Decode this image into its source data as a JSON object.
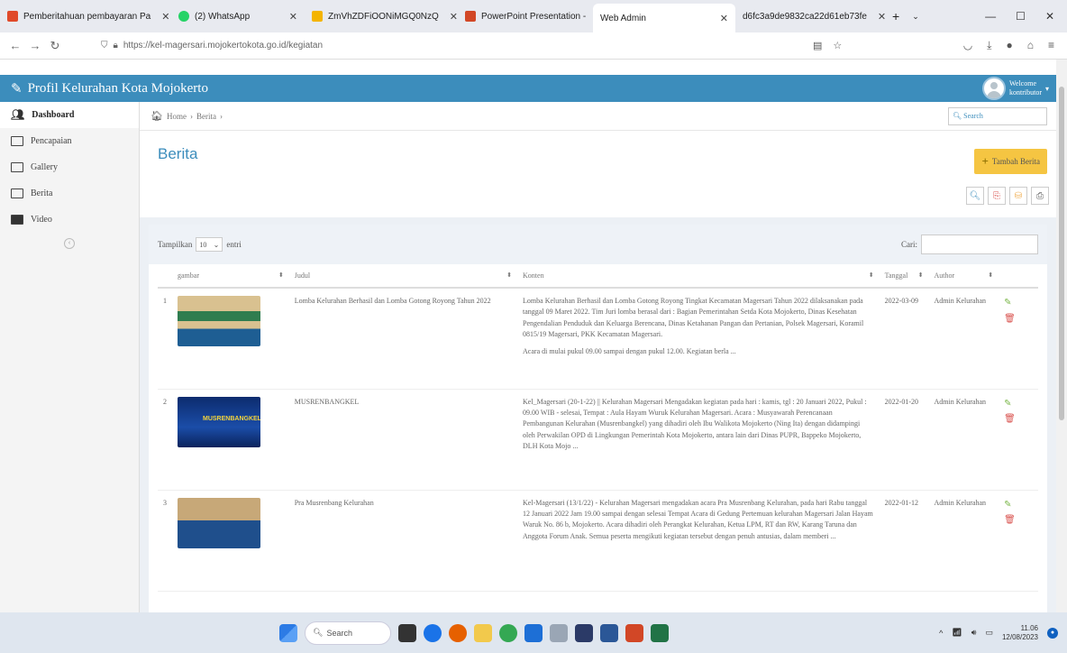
{
  "browser": {
    "tabs": [
      {
        "label": "Pemberitahuan pembayaran Pa",
        "color": "#e04a2a"
      },
      {
        "label": "(2) WhatsApp",
        "color": "#25d366"
      },
      {
        "label": "ZmVhZDFiOONiMGQ0NzQ",
        "color": "#f4b400"
      },
      {
        "label": "PowerPoint Presentation -",
        "color": "#d24726"
      },
      {
        "label": "Web Admin",
        "color": "#ffffff"
      },
      {
        "label": "d6fc3a9de9832ca22d61eb73fe",
        "color": "#888888"
      }
    ],
    "url": "https://kel-magersari.mojokertokota.go.id/kegiatan"
  },
  "app": {
    "brand": "Profil Kelurahan Kota Mojokerto",
    "user_line1": "Welcome",
    "user_line2": "kontributor"
  },
  "sidebar": {
    "items": [
      {
        "label": "Dashboard"
      },
      {
        "label": "Pencapaian"
      },
      {
        "label": "Gallery"
      },
      {
        "label": "Berita"
      },
      {
        "label": "Video"
      }
    ]
  },
  "breadcrumb": {
    "home": "Home",
    "current": "Berita",
    "search_placeholder": "Search"
  },
  "page": {
    "title": "Berita",
    "add_button": "Tambah Berita"
  },
  "table": {
    "show_label": "Tampilkan",
    "show_value": "10",
    "entries_label": "entri",
    "search_label": "Cari:",
    "headers": [
      "gambar",
      "Judul",
      "Konten",
      "Tanggal",
      "Author"
    ],
    "rows": [
      {
        "no": "1",
        "title": "Lomba Kelurahan Berhasil dan Lomba Gotong Royong Tahun 2022",
        "content": "Lomba Kelurahan Berhasil dan Lomba Gotong Royong Tingkat Kecamatan Magersari Tahun 2022 dilaksanakan pada tanggal 09 Maret 2022. Tim Juri lomba berasal dari : Bagian Pemerintahan Setda Kota Mojokerto, Dinas Kesehatan Pengendalian Penduduk dan Keluarga Berencana, Dinas Ketahanan Pangan dan Pertanian, Polsek Magersari, Koramil 0815/19 Magersari, PKK Kecamatan Magersari.",
        "content2": "Acara di mulai pukul 09.00 sampai dengan pukul 12.00. Kegiatan berla ...",
        "date": "2022-03-09",
        "author": "Admin Kelurahan"
      },
      {
        "no": "2",
        "title": "MUSRENBANGKEL",
        "content": "Kel_Magersari (20-1-22) || Kelurahan Magersari Mengadakan kegiatan pada hari : kamis, tgl : 20 Januari 2022, Pukul : 09.00 WIB - selesai, Tempat : Aula Hayam Wuruk Kelurahan Magersari. Acara : Musyawarah Perencanaan Pembangunan Kelurahan (Musrenbangkel) yang dihadiri oleh Ibu Walikota Mojokerto (Ning Ita) dengan didampingi oleh Perwakilan OPD di Lingkungan Pemerintah Kota Mojokerto, antara lain dari Dinas PUPR, Bappeko Mojokerto, DLH Kota Mojo ...",
        "content2": "",
        "date": "2022-01-20",
        "author": "Admin Kelurahan"
      },
      {
        "no": "3",
        "title": "Pra Musrenbang Kelurahan",
        "content": "Kel-Magersari (13/1/22) - Kelurahan Magersari mengadakan acara Pra Musrenbang Kelurahan, pada hari Rabu tanggal 12 Januari 2022 Jam 19.00 sampai dengan selesai Tempat Acara di Gedung Pertemuan kelurahan Magersari Jalan Hayam Waruk No. 86 b, Mojokerto. Acara dihadiri oleh Perangkat Kelurahan, Ketua LPM, RT dan RW, Karang Taruna dan Anggota Forum Anak. Semua peserta mengikuti kegiatan tersebut dengan penuh antusias, dalam memberi ...",
        "content2": "",
        "date": "2022-01-12",
        "author": "Admin Kelurahan"
      }
    ],
    "thumb_text": "MUSRENBANGKEL"
  },
  "taskbar": {
    "search": "Search",
    "time": "11.06",
    "date": "12/08/2023"
  }
}
